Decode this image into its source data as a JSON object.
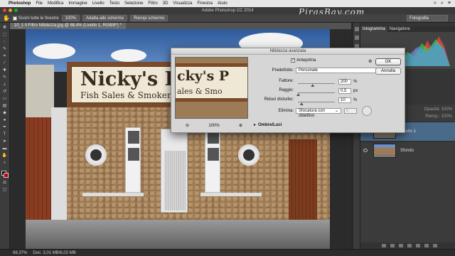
{
  "menubar": {
    "app": "Photoshop",
    "items": [
      "File",
      "Modifica",
      "Immagine",
      "Livello",
      "Testo",
      "Selezione",
      "Filtro",
      "3D",
      "Visualizza",
      "Finestra",
      "Aiuto"
    ]
  },
  "window_title": "Adobe Photoshop CC 2014",
  "watermark": "PirasBay.com",
  "options_bar": {
    "scroll_all_label": "Scorri tutte le finestre",
    "zoom_btn": "100%",
    "fit_btn": "Adatta allo schermo",
    "fill_btn": "Riempi schermo",
    "workspace": "Fotografia"
  },
  "document_tab": "10_1 Il Filtro Nitidezza.jpg @ 88,4% (Livello 1, RGB/8*) *",
  "panels": {
    "tab_histogram": "Istogramma",
    "tab_navigator": "Navigatore",
    "opacity_label": "Opacità:",
    "opacity_value": "100%",
    "fill_label": "Riemp.:",
    "fill_value": "100%",
    "layers": [
      {
        "name": "Livello 1"
      },
      {
        "name": "Sfondo"
      }
    ]
  },
  "photo": {
    "sign_line1": "Nicky's Place",
    "sign_line2": "Fish Sales & Smokery"
  },
  "dialog": {
    "title": "Nitidezza avanzata",
    "preview_sign_line1": "cky's P",
    "preview_sign_line2": "ales & Smo",
    "zoom_value": "100%",
    "preview_checkbox_label": "Anteprima",
    "preset_label": "Predefinito:",
    "preset_value": "Personale",
    "amount_label": "Fattore:",
    "amount_value": "200",
    "amount_unit": "%",
    "amount_fraction": 0.4,
    "radius_label": "Raggio:",
    "radius_value": "0,5",
    "radius_unit": "px",
    "radius_fraction": 0.01,
    "noise_label": "Riduci disturbo:",
    "noise_value": "10",
    "noise_unit": "%",
    "noise_fraction": 0.1,
    "remove_label": "Elimina:",
    "remove_value": "Sfocatura con obiettivo",
    "angle_value": "0",
    "shadows_label": "Ombre/Luci",
    "ok_label": "OK",
    "cancel_label": "Annulla"
  },
  "status": {
    "zoom": "88,37%",
    "doc": "Doc: 3,01 MB/6,02 MB"
  },
  "colors": {
    "foreground": "#000000",
    "background": "#cc0000",
    "ui_dark": "#282828"
  }
}
